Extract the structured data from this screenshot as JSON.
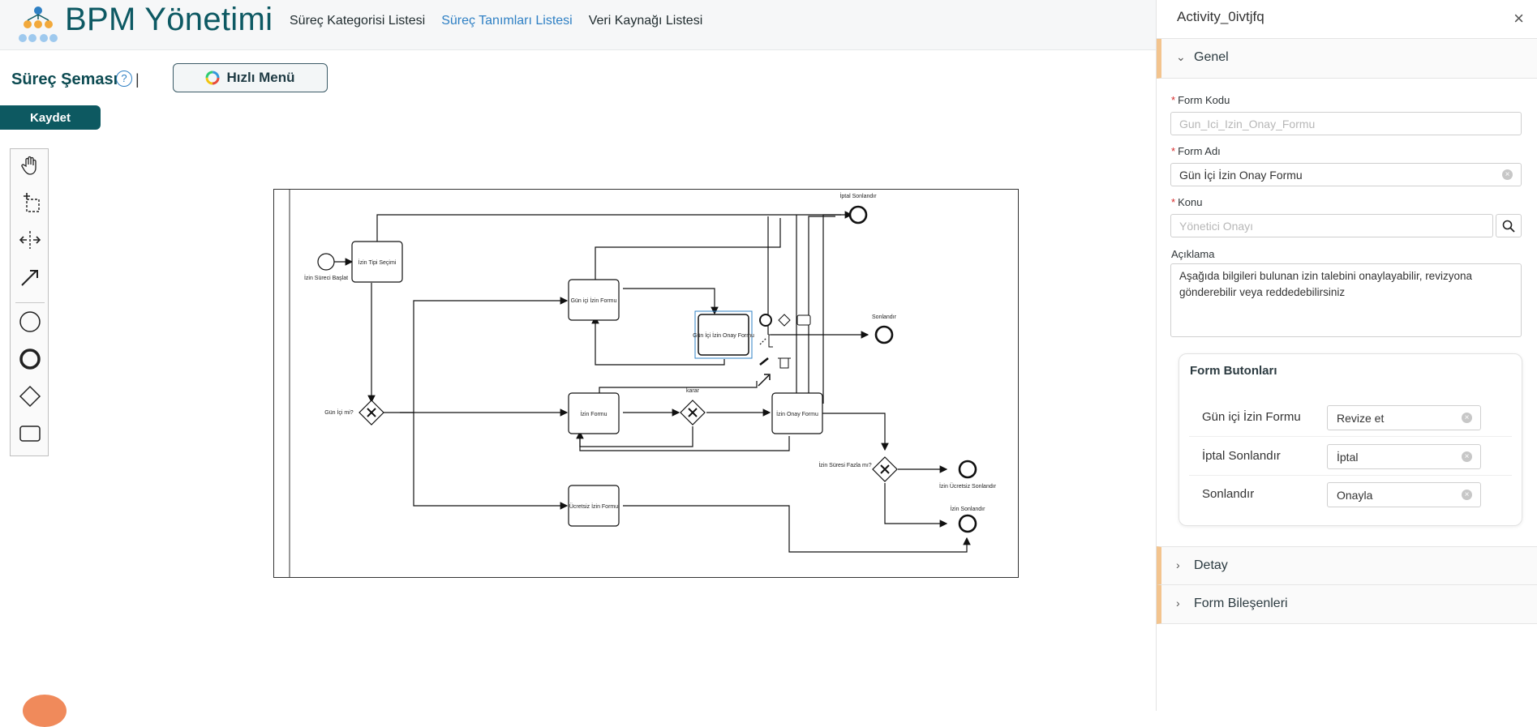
{
  "app": {
    "title": "BPM Yönetimi"
  },
  "nav": {
    "items": [
      {
        "label": "Süreç Kategorisi Listesi",
        "active": false
      },
      {
        "label": "Süreç Tanımları Listesi",
        "active": true
      },
      {
        "label": "Veri Kaynağı Listesi",
        "active": false
      }
    ]
  },
  "toolbar": {
    "schema_title": "Süreç Şeması",
    "help_icon": "question-icon",
    "separator": "|",
    "quick_menu_label": "Hızlı Menü",
    "save_label": "Kaydet"
  },
  "palette": {
    "tools": [
      "hand-tool-icon",
      "lasso-tool-icon",
      "space-tool-icon",
      "connect-tool-icon",
      "start-event-icon",
      "end-event-icon",
      "gateway-icon",
      "task-icon"
    ]
  },
  "diagram": {
    "labels": {
      "start": "İzin Süreci Başlat",
      "task_select": "İzin Tipi Seçimi",
      "task_daily": "Gün içi İzin Formu",
      "task_daily_approve": "Gün İçi İzin Onay Formu",
      "task_leave": "İzin Formu",
      "task_leave_approve": "İzin Onay Formu",
      "task_unpaid": "Ücretsiz İzin Formu",
      "gw_daily": "Gün İçi mi?",
      "gw_decision": "karar",
      "gw_duration": "İzin Süresi Fazla mı?",
      "end_cancel": "İptal Sonlandır",
      "end_finish": "Sonlandır",
      "end_unpaid": "İzin Ücretsiz Sonlandır",
      "end_leave": "İzin Sonlandır"
    }
  },
  "panel": {
    "element_id": "Activity_0ivtjfq",
    "close_label": "×",
    "sections": {
      "general": "Genel",
      "detail": "Detay",
      "components": "Form Bileşenleri"
    },
    "fields": {
      "form_code_label": "Form Kodu",
      "form_code_placeholder": "Gun_Ici_Izin_Onay_Formu",
      "form_name_label": "Form Adı",
      "form_name_value": "Gün İçi İzin Onay Formu",
      "subject_label": "Konu",
      "subject_placeholder": "Yönetici Onayı",
      "description_label": "Açıklama",
      "description_value": "Aşağıda bilgileri bulunan izin talebini onaylayabilir, revizyona gönderebilir veya reddedebilirsiniz"
    },
    "form_buttons": {
      "title": "Form Butonları",
      "rows": [
        {
          "name": "Gün içi İzin Formu",
          "value": "Revize et"
        },
        {
          "name": "İptal Sonlandır",
          "value": "İptal"
        },
        {
          "name": "Sonlandır",
          "value": "Onayla"
        }
      ]
    }
  },
  "colors": {
    "brand": "#0d5963",
    "link_active": "#2f80c4",
    "section_accent": "#f3c48e",
    "required": "#d62b2b"
  }
}
